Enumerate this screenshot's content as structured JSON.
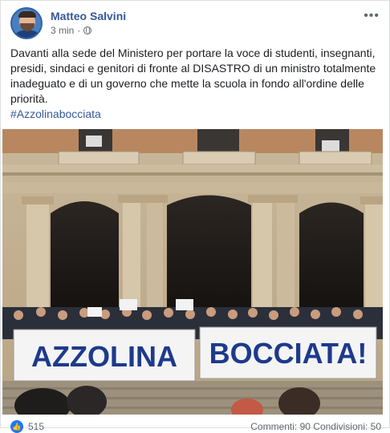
{
  "post": {
    "author": "Matteo Salvini",
    "timestamp": "3 min",
    "separator": "·",
    "audience_icon": "globe-icon",
    "more_label": "•••",
    "body": "Davanti alla sede del Ministero per portare la voce di studenti, insegnanti, presidi, sindaci e genitori di fronte al DISASTRO di un ministro totalmente inadeguato e di un governo che mette la scuola in fondo all'ordine delle priorità.",
    "hashtag": "#Azzolinabocciata"
  },
  "photo": {
    "banner_left": "AZZOLINA",
    "banner_right": "BOCCIATA!"
  },
  "footer": {
    "like_count": "515",
    "comments_shares": "Commenti: 90  Condivisioni: 50"
  },
  "colors": {
    "link": "#365899",
    "banner_text": "#1d3a8c",
    "building": "#d8cbb3"
  }
}
